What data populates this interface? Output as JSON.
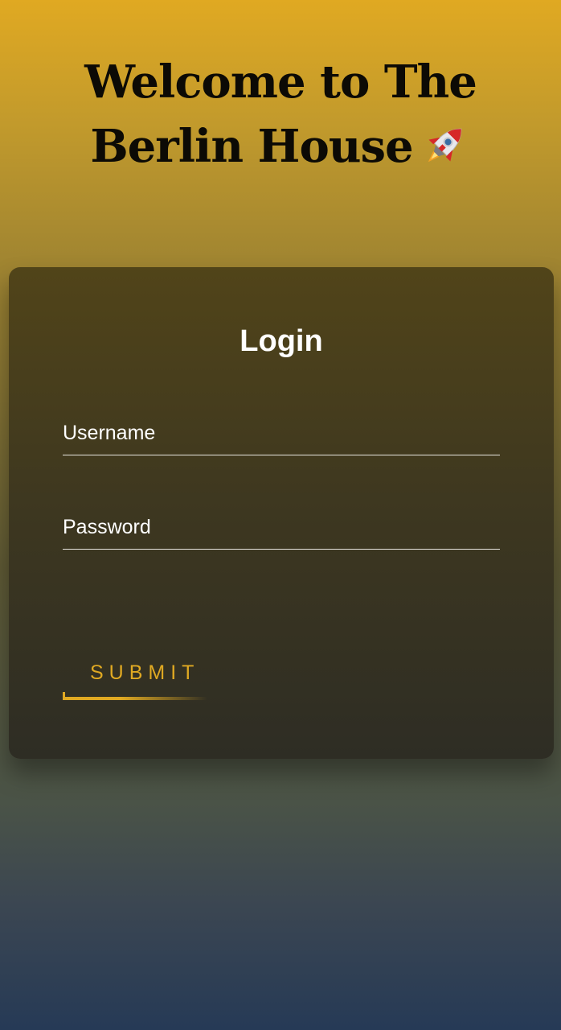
{
  "header": {
    "title": "Welcome to The Berlin House",
    "emoji_icon": "rocket-icon"
  },
  "login_form": {
    "heading": "Login",
    "username": {
      "label": "Username",
      "value": ""
    },
    "password": {
      "label": "Password",
      "value": ""
    },
    "submit_label": "SUBMIT"
  },
  "colors": {
    "accent": "#e0a922",
    "background_top": "#e0a922",
    "background_bottom": "#263a56",
    "card_top": "#514419",
    "card_bottom": "#2e2d24",
    "title_text": "#0c0a05",
    "field_text": "#ffffff"
  }
}
